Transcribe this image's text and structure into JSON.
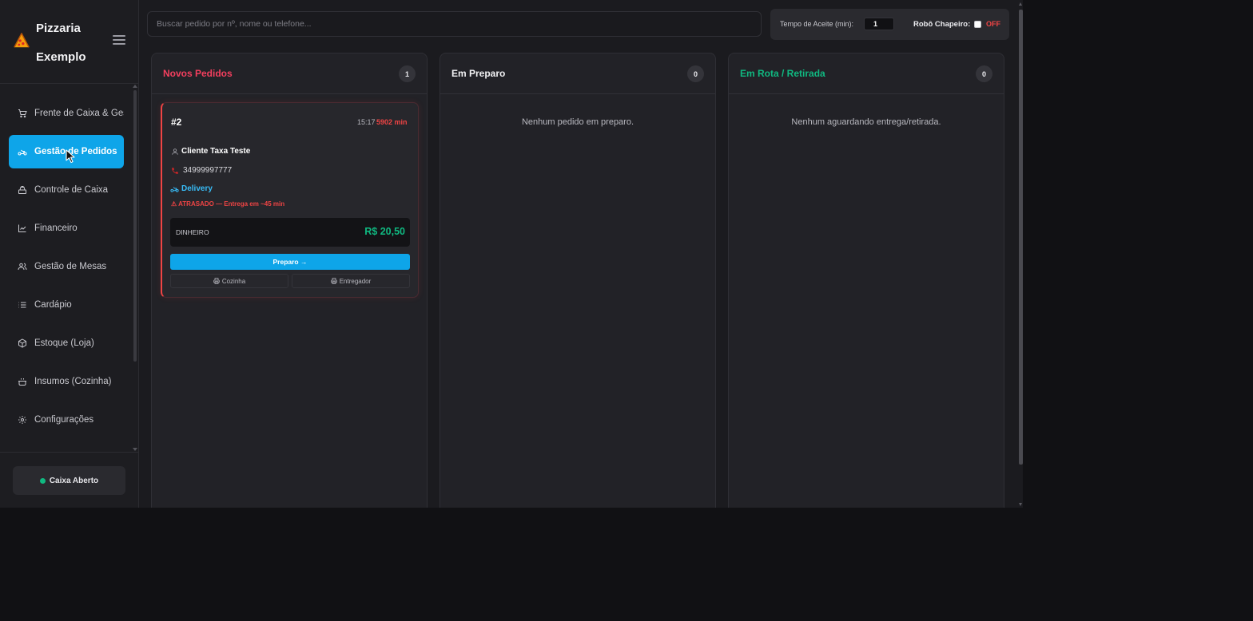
{
  "brand": {
    "name": "Pizzaria Exemplo",
    "logo_icon": "pizza-slice-icon"
  },
  "sidebar": {
    "items": [
      {
        "label": "Frente de Caixa & Gestor",
        "icon": "cart-icon",
        "active": false
      },
      {
        "label": "Gestão de Pedidos",
        "icon": "motorcycle-icon",
        "active": true
      },
      {
        "label": "Controle de Caixa",
        "icon": "cash-register-icon",
        "active": false
      },
      {
        "label": "Financeiro",
        "icon": "line-chart-icon",
        "active": false
      },
      {
        "label": "Gestão de Mesas",
        "icon": "users-icon",
        "active": false
      },
      {
        "label": "Cardápio",
        "icon": "list-icon",
        "active": false
      },
      {
        "label": "Estoque (Loja)",
        "icon": "box-icon",
        "active": false
      },
      {
        "label": "Insumos (Cozinha)",
        "icon": "cooking-pot-icon",
        "active": false
      },
      {
        "label": "Configurações",
        "icon": "gear-icon",
        "active": false
      }
    ],
    "cash_status": "Caixa Aberto",
    "cash_status_color": "#10b981"
  },
  "topbar": {
    "search_placeholder": "Buscar pedido por nº, nome ou telefone...",
    "accept_time_label": "Tempo de Aceite (min):",
    "accept_time_value": "1",
    "robot_label": "Robô Chapeiro:",
    "robot_state": "OFF"
  },
  "columns": [
    {
      "title": "Novos Pedidos",
      "count": "1",
      "color": "#f43f5e",
      "empty_text": ""
    },
    {
      "title": "Em Preparo",
      "count": "0",
      "color": "#f2f2f4",
      "empty_text": "Nenhum pedido em preparo."
    },
    {
      "title": "Em Rota / Retirada",
      "count": "0",
      "color": "#10b981",
      "empty_text": "Nenhum aguardando entrega/retirada."
    }
  ],
  "order": {
    "id": "#2",
    "time": "15:17",
    "elapsed": "5902 min",
    "customer": "Cliente Taxa Teste",
    "phone": "34999997777",
    "type": "Delivery",
    "alert": "ATRASADO — Entrega em ~45 min",
    "payment_method": "DINHEIRO",
    "total": "R$ 20,50",
    "primary_action": "Preparo →",
    "print_kitchen": "Cozinha",
    "print_courier": "Entregador"
  },
  "colors": {
    "accent": "#0ea5e9",
    "danger": "#ef4444",
    "success": "#10b981"
  }
}
